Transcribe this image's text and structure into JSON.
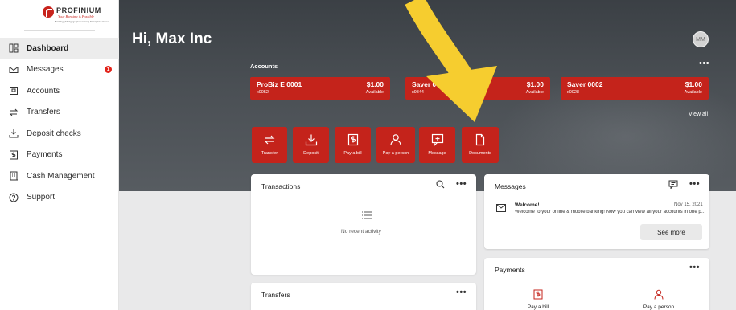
{
  "brand": {
    "name": "PROFINIUM",
    "tagline": "Your Banking is Possible",
    "subline": "Banking | Mortgage | Insurance | Trust | Investment",
    "accent": "#c4231b"
  },
  "sidebar": {
    "items": [
      {
        "label": "Dashboard",
        "icon": "dashboard-icon"
      },
      {
        "label": "Messages",
        "icon": "envelope-icon",
        "badge": "1"
      },
      {
        "label": "Accounts",
        "icon": "account-card-icon"
      },
      {
        "label": "Transfers",
        "icon": "transfer-arrows-icon"
      },
      {
        "label": "Deposit checks",
        "icon": "download-tray-icon"
      },
      {
        "label": "Payments",
        "icon": "dollar-receipt-icon"
      },
      {
        "label": "Cash Management",
        "icon": "building-icon"
      },
      {
        "label": "Support",
        "icon": "help-circle-icon"
      }
    ]
  },
  "header": {
    "greeting": "Hi, Max Inc",
    "avatar_initials": "MM"
  },
  "accounts": {
    "label": "Accounts",
    "more": "•••",
    "view_all": "View all",
    "items": [
      {
        "name": "ProBiz E 0001",
        "number": "x0052",
        "balance": "$1.00",
        "status": "Available"
      },
      {
        "name": "Saver 0",
        "number": "x9844",
        "balance": "$1.00",
        "status": "Available"
      },
      {
        "name": "Saver 0002",
        "number": "x0028",
        "balance": "$1.00",
        "status": "Available"
      }
    ]
  },
  "quick_actions": [
    {
      "label": "Transfer",
      "icon": "transfer-arrows-icon"
    },
    {
      "label": "Deposit",
      "icon": "download-tray-icon"
    },
    {
      "label": "Pay a bill",
      "icon": "dollar-receipt-icon"
    },
    {
      "label": "Pay a person",
      "icon": "person-icon"
    },
    {
      "label": "Message",
      "icon": "chat-plus-icon"
    },
    {
      "label": "Documents",
      "icon": "document-icon"
    }
  ],
  "transactions": {
    "title": "Transactions",
    "more": "•••",
    "empty_text": "No recent activity"
  },
  "transfers": {
    "title": "Transfers",
    "more": "•••"
  },
  "messages": {
    "title": "Messages",
    "more": "•••",
    "item": {
      "title": "Welcome!",
      "date": "Nov 15, 2021",
      "body": "Welcome to your online & mobile banking! Now you can view all your accounts in one place."
    },
    "see_more": "See more"
  },
  "payments": {
    "title": "Payments",
    "more": "•••",
    "options": [
      {
        "label": "Pay a bill",
        "icon": "dollar-receipt-icon"
      },
      {
        "label": "Pay a person",
        "icon": "person-icon"
      }
    ]
  }
}
